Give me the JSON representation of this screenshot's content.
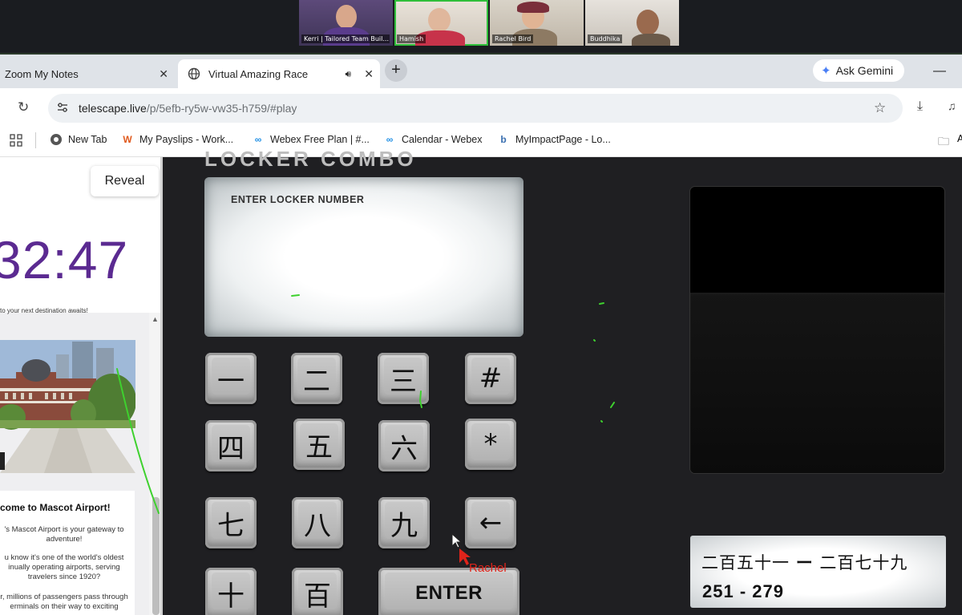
{
  "zoom": {
    "participants": [
      {
        "name": "Kerri | Tailored Team Buil..."
      },
      {
        "name": "Hamish"
      },
      {
        "name": "Rachel Bird"
      },
      {
        "name": "Buddhika"
      }
    ]
  },
  "browser": {
    "tabs": [
      {
        "title": "Zoom My Notes",
        "close": "✕"
      },
      {
        "title": "Virtual Amazing Race",
        "close": "✕"
      }
    ],
    "new_tab": "+",
    "gemini_label": "Ask Gemini",
    "minimize": "—",
    "url_domain": "telescape.live",
    "url_path": "/p/5efb-ry5w-vw35-h759/#play",
    "bookmarks": [
      {
        "label": "New Tab",
        "icon": "chrome-icon"
      },
      {
        "label": "My Payslips - Work...",
        "icon": "workday-icon"
      },
      {
        "label": "Webex Free Plan | #...",
        "icon": "webex-icon"
      },
      {
        "label": "Calendar - Webex",
        "icon": "webex-icon"
      },
      {
        "label": "MyImpactPage - Lo...",
        "icon": "impact-icon"
      }
    ],
    "bookmark_overflow": "A"
  },
  "left_panel": {
    "reveal_label": "Reveal",
    "timer": "32:47",
    "cut_text": "to your next destination awaits!",
    "card": {
      "title": "come to Mascot Airport!",
      "paragraphs": [
        "'s Mascot Airport is your gateway to adventure!",
        "u know it's one of the world's oldest inually operating airports, serving travelers since 1920?",
        "r, millions of passengers pass through erminals on their way to exciting"
      ]
    }
  },
  "game": {
    "cut_heading": "LOCKER COMBO",
    "screen_label": "ENTER LOCKER NUMBER",
    "keys": [
      "一",
      "二",
      "三",
      "#",
      "四",
      "五",
      "六",
      "*",
      "七",
      "八",
      "九",
      "←",
      "十",
      "百"
    ],
    "enter_label": "ENTER",
    "hint_kanji_from": "二百五十一",
    "hint_dash": "ー",
    "hint_kanji_to": "二百七十九",
    "hint_numbers": "251 - 279",
    "cursor_user": "Rachel"
  },
  "colors": {
    "timer": "#5b2a91",
    "zoom_active_border": "#2fbf3a",
    "cursor_name": "#e0241b",
    "annotation_stroke": "#3ed12e"
  }
}
